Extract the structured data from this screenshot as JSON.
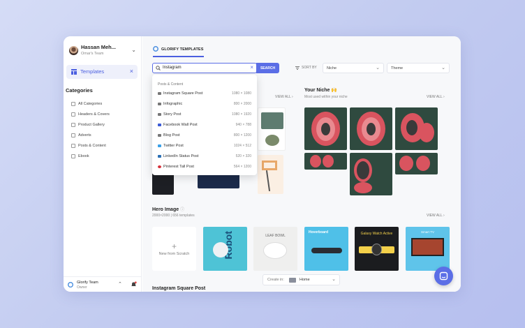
{
  "user": {
    "name": "Hassan Meh...",
    "team": "Omar's Team"
  },
  "sidebar": {
    "templates_label": "Templates",
    "categories_title": "Categories",
    "categories": [
      "All Categories",
      "Headers & Covers",
      "Product Gallery",
      "Adverts",
      "Posts & Content",
      "Ebook"
    ],
    "team_name": "Glorify Team",
    "team_role": "Owner"
  },
  "header": {
    "tab_label": "GLORIFY TEMPLATES"
  },
  "search": {
    "value": "Instagram",
    "button": "SEARCH"
  },
  "sort": {
    "label": "SORT BY",
    "niche": "Niche",
    "theme": "Theme"
  },
  "dropdown": {
    "heading": "Posts & Content",
    "items": [
      {
        "label": "Instagram Square Post",
        "size": "1080 × 1080"
      },
      {
        "label": "Infographic",
        "size": "800 × 2000"
      },
      {
        "label": "Story Post",
        "size": "1080 × 1920"
      },
      {
        "label": "Facebook Wall Post",
        "size": "940 × 788"
      },
      {
        "label": "Blog Post",
        "size": "800 × 1200"
      },
      {
        "label": "Twitter Post",
        "size": "1024 × 512"
      },
      {
        "label": "LinkedIn Status Post",
        "size": "520 × 320"
      },
      {
        "label": "Pinterest Tall Post",
        "size": "564 × 1200"
      }
    ]
  },
  "sections": {
    "view_all": "VIEW ALL",
    "niche_title": "Your Niche 🙌",
    "niche_sub": "Most used within your niche",
    "hero_title": "Hero Image",
    "hero_sub": "2000×2000 | 656 templates",
    "next_title": "Instagram Square Post"
  },
  "hero_cards": {
    "new_label": "New from Scratch",
    "items": [
      "Robot",
      "LEAF BOWL",
      "Hoverboard",
      "Galaxy Watch Active",
      "Smart TV"
    ]
  },
  "create_in": {
    "label": "Create in:",
    "value": "Home"
  },
  "colors": {
    "accent": "#5b6ee6",
    "teal_dark": "#2f4a3f",
    "red_egg": "#d9545f"
  }
}
